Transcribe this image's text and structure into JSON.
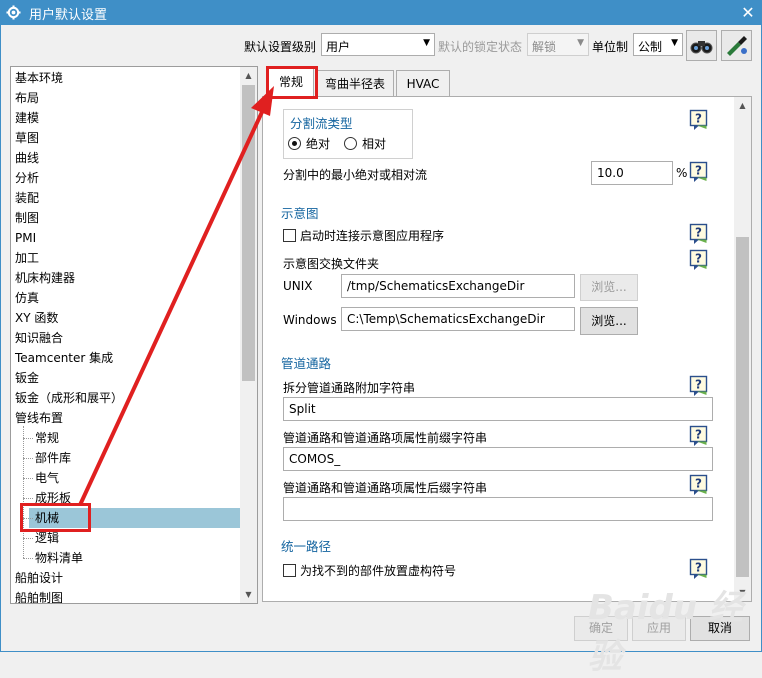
{
  "window": {
    "title": "用户默认设置",
    "close_glyph": "✕"
  },
  "toolbar": {
    "level_label": "默认设置级别",
    "level_value": "用户",
    "lock_label": "默认的锁定状态",
    "lock_value": "解锁",
    "unit_label": "单位制",
    "unit_value": "公制"
  },
  "tree": {
    "items": [
      "基本环境",
      "布局",
      "建模",
      "草图",
      "曲线",
      "分析",
      "装配",
      "制图",
      "PMI",
      "加工",
      "机床构建器",
      "仿真",
      "XY 函数",
      "知识融合",
      "Teamcenter 集成",
      "钣金",
      "钣金（成形和展平）",
      "管线布置"
    ],
    "children": [
      "常规",
      "部件库",
      "电气",
      "成形板",
      "机械",
      "逻辑",
      "物料清单"
    ],
    "after": [
      "船舶设计",
      "船舶制图"
    ],
    "selected": "机械"
  },
  "tabs": [
    "常规",
    "弯曲半径表",
    "HVAC"
  ],
  "active_tab": "常规",
  "panel": {
    "split_group_title": "分割流类型",
    "radio_absolute": "绝对",
    "radio_relative": "相对",
    "min_flow_label": "分割中的最小绝对或相对流",
    "min_flow_value": "10.0",
    "percent": "%",
    "schematic_title": "示意图",
    "schematic_connect": "启动时连接示意图应用程序",
    "exchange_folder": "示意图交换文件夹",
    "unix_label": "UNIX",
    "unix_value": "/tmp/SchematicsExchangeDir",
    "windows_label": "Windows",
    "windows_value": "C:\\Temp\\SchematicsExchangeDir",
    "browse": "浏览...",
    "pipe_title": "管道通路",
    "split_suffix_label": "拆分管道通路附加字符串",
    "split_suffix_value": "Split",
    "prefix_label": "管道通路和管道通路项属性前缀字符串",
    "prefix_value": "COMOS_",
    "suffix_label": "管道通路和管道通路项属性后缀字符串",
    "suffix_value": "",
    "unified_title": "统一路径",
    "unified_check": "为找不到的部件放置虚构符号"
  },
  "buttons": {
    "ok": "确定",
    "apply": "应用",
    "cancel": "取消"
  },
  "watermark": "Baidu 经验",
  "colors": {
    "titlebar": "#3f8fc7",
    "selection": "#9bc6d8",
    "annotation": "#e02020",
    "section_title": "#1565a0"
  },
  "icons": {
    "app": "gear-icon",
    "help": "help-icon",
    "tool1": "binoculars-icon",
    "tool2": "settings-wand-icon"
  }
}
